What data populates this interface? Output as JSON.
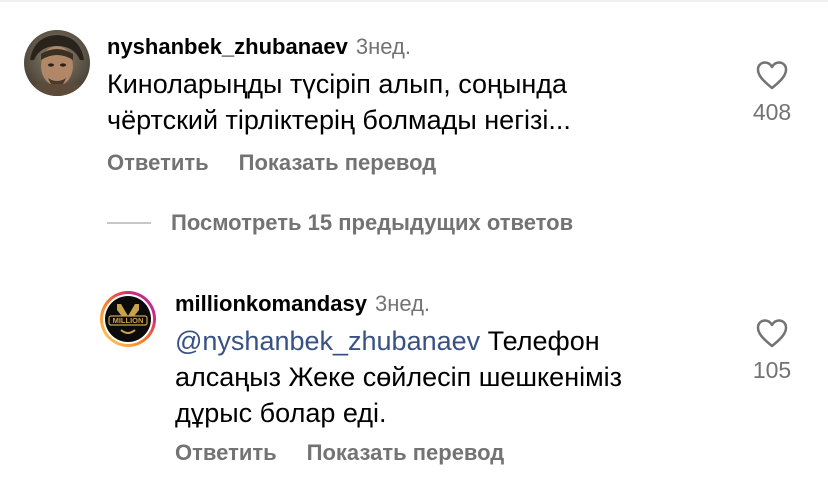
{
  "comments": [
    {
      "username": "nyshanbek_zhubanaev",
      "time": "3нед.",
      "text": "Киноларыңды түсіріп алып, соңында\nчёртский тірліктерің болмады негізі...",
      "likes": "408",
      "reply_label": "Ответить",
      "translate_label": "Показать перевод",
      "avatar_icon": "user-avatar-photo"
    },
    {
      "username": "millionkomandasy",
      "time": "3нед.",
      "mention": "@nyshanbek_zhubanaev",
      "text": " Телефон\nалсаңыз Жеке сөйлесіп шешкеніміз\nдұрыс болар еді.",
      "likes": "105",
      "reply_label": "Ответить",
      "translate_label": "Показать перевод",
      "avatar_icon": "million-logo-avatar",
      "avatar_logo_text": "MILLION"
    }
  ],
  "view_replies_label": "Посмотреть 15 предыдущих ответов",
  "colors": {
    "secondary_text": "#737373",
    "mention": "#385185",
    "divider": "#c7c7c7",
    "logo_gold": "#c9a34a",
    "story_ring": "#d6249f"
  }
}
